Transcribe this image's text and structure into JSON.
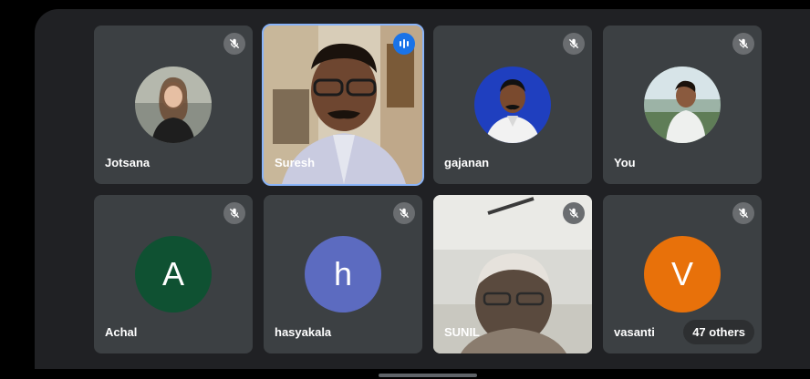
{
  "participants": [
    {
      "name": "Jotsana",
      "muted": true,
      "display": "photo"
    },
    {
      "name": "Suresh",
      "muted": false,
      "speaking": true,
      "display": "video"
    },
    {
      "name": "gajanan",
      "muted": true,
      "display": "photo"
    },
    {
      "name": "You",
      "muted": true,
      "display": "photo"
    },
    {
      "name": "Achal",
      "muted": true,
      "display": "letter",
      "letter": "A",
      "avatar_color": "#0f5132"
    },
    {
      "name": "hasyakala",
      "muted": true,
      "display": "letter",
      "letter": "h",
      "avatar_color": "#5c6bc0"
    },
    {
      "name": "SUNIL",
      "muted": true,
      "display": "video"
    },
    {
      "name": "vasanti",
      "muted": true,
      "display": "letter",
      "letter": "V",
      "avatar_color": "#e8710a"
    }
  ],
  "others_label": "47 others",
  "icons": {
    "muted": "mic-off-icon",
    "speaking": "audio-level-icon"
  },
  "colors": {
    "background": "#202124",
    "tile": "#3c4043",
    "speaking_accent": "#1a73e8"
  }
}
